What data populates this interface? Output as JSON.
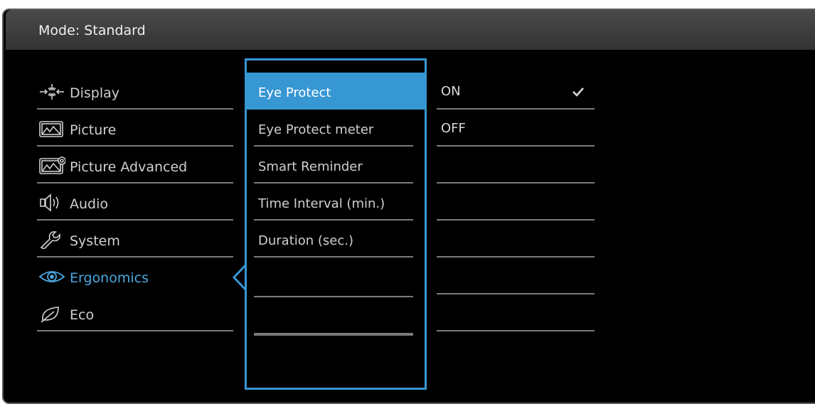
{
  "header": {
    "mode_label": "Mode: Standard"
  },
  "main_menu": {
    "items": [
      {
        "label": "Display",
        "icon": "display-arrows-icon"
      },
      {
        "label": "Picture",
        "icon": "picture-icon"
      },
      {
        "label": "Picture Advanced",
        "icon": "picture-advanced-icon"
      },
      {
        "label": "Audio",
        "icon": "speaker-icon"
      },
      {
        "label": "System",
        "icon": "wrench-icon"
      },
      {
        "label": "Ergonomics",
        "icon": "eye-icon",
        "active": true
      },
      {
        "label": "Eco",
        "icon": "leaf-icon"
      }
    ]
  },
  "sub_menu": {
    "items": [
      {
        "label": "Eye Protect",
        "selected": true
      },
      {
        "label": "Eye Protect meter"
      },
      {
        "label": "Smart Reminder"
      },
      {
        "label": "Time Interval (min.)"
      },
      {
        "label": "Duration (sec.)"
      },
      {
        "label": ""
      },
      {
        "label": ""
      },
      {
        "label": ""
      }
    ]
  },
  "options": {
    "items": [
      {
        "label": "ON",
        "checked": true
      },
      {
        "label": "OFF"
      },
      {
        "label": ""
      },
      {
        "label": ""
      },
      {
        "label": ""
      },
      {
        "label": ""
      },
      {
        "label": ""
      }
    ]
  },
  "colors": {
    "accent": "#3797d3",
    "active_text": "#4aa8e0",
    "background": "#000000"
  }
}
